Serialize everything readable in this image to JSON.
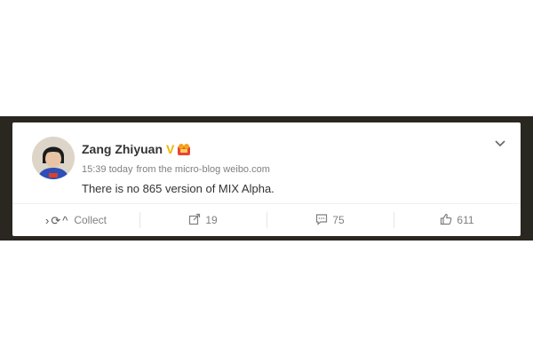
{
  "post": {
    "author": "Zang Zhiyuan",
    "verified_badge": "V",
    "meta_time": "15:39 today",
    "meta_source": "from the micro-blog weibo.com",
    "text": "There is no 865 version of MIX Alpha."
  },
  "actions": {
    "collect_label": "Collect",
    "repost_count": "19",
    "comment_count": "75",
    "like_count": "611"
  },
  "icons": {
    "chevron_right": "›",
    "refresh": "⟳",
    "caret_up": "^"
  },
  "colors": {
    "frame": "#2a2620",
    "verified": "#f0b400",
    "text": "#333333",
    "muted": "#808080"
  }
}
